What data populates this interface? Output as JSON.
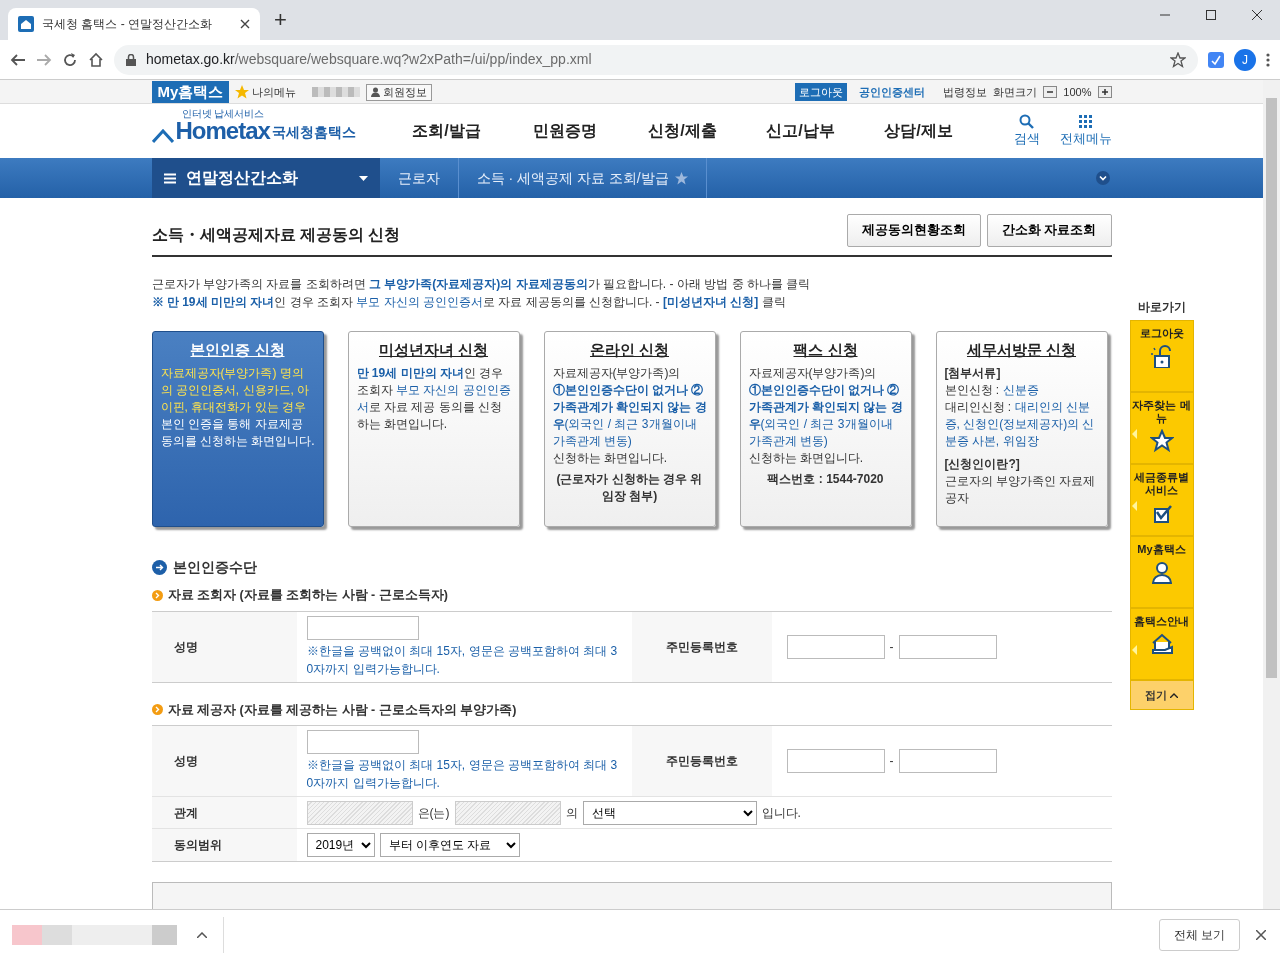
{
  "browser": {
    "tab_title": "국세청 홈택스 - 연말정산간소화",
    "new_tab": "+",
    "address_host": "hometax.go.kr",
    "address_path": "/websquare/websquare.wq?w2xPath=/ui/pp/index_pp.xml",
    "profile": "J"
  },
  "utility_bar": {
    "my_label": "My홈택스",
    "my_menu": "나의메뉴",
    "member_info": "회원정보",
    "logout": "로그아웃",
    "cert_center": "공인인증센터",
    "links": [
      "법령정보",
      "화면크기"
    ],
    "zoom": "100%"
  },
  "header": {
    "logo_tagline": "인터넷 납세서비스",
    "logo": "Hometax",
    "logo_suffix": "국세청홈택스",
    "menu": [
      "조회/발급",
      "민원증명",
      "신청/제출",
      "신고/납부",
      "상담/제보"
    ],
    "tools": [
      {
        "label": "검색",
        "kind": "search"
      },
      {
        "label": "전체메뉴",
        "kind": "grid"
      }
    ]
  },
  "breadcrumb": {
    "section": "연말정산간소화",
    "items": [
      "근로자",
      "소득 · 세액공제 자료 조회/발급"
    ]
  },
  "page": {
    "title": "소득・세액공제자료 제공동의 신청",
    "buttons": [
      "제공동의현황조회",
      "간소화 자료조회"
    ],
    "notice": [
      [
        {
          "text": "근로자가 부양가족의 자료를 조회하려면 ",
          "kind": "plain"
        },
        {
          "text": "그 부양가족(자료제공자)의 자료제공동의",
          "kind": "strong"
        },
        {
          "text": "가 필요합니다. - 아래 방법 중 하나를 클릭",
          "kind": "plain"
        }
      ],
      [
        {
          "text": "※ 만 19세 미만의 자녀",
          "kind": "strong"
        },
        {
          "text": "인 경우 조회자 ",
          "kind": "plain"
        },
        {
          "text": "부모 자신의 공인인증서",
          "kind": "link"
        },
        {
          "text": "로 자료 제공동의를 신청합니다. - ",
          "kind": "plain"
        },
        {
          "text": "[미성년자녀 신청]",
          "kind": "strong"
        },
        {
          "text": " 클릭",
          "kind": "plain"
        }
      ]
    ]
  },
  "cards": [
    {
      "title": "본인인증 신청",
      "selected": true,
      "paragraphs": [
        [
          {
            "text": "자료제공자(부양가족) 명의의 공인인증서, 신용카드, 아이핀,  휴대전화가 있는 경우",
            "kind": "highlight"
          },
          {
            "text": " 본인 인증을 통해 자료제공 동의를 신청하는 화면입니다.",
            "kind": "plain"
          }
        ]
      ]
    },
    {
      "title": "미성년자녀 신청",
      "selected": false,
      "paragraphs": [
        [
          {
            "text": "만 19세 미만의 자녀",
            "kind": "strong"
          },
          {
            "text": "인 경우 조회자 ",
            "kind": "plain"
          },
          {
            "text": "부모 자신의 공인인증서",
            "kind": "link"
          },
          {
            "text": "로 자료 제공 동의를 신청하는 화면입니다.",
            "kind": "plain"
          }
        ]
      ]
    },
    {
      "title": "온라인 신청",
      "selected": false,
      "paragraphs": [
        [
          {
            "text": "자료제공자(부양가족)의",
            "kind": "plain"
          }
        ],
        [
          {
            "text": "①본인인증수단이 없거나 ②가족관계가 확인되지 않는 경우",
            "kind": "strong"
          },
          {
            "text": "(외국인 / 최근 3개월이내 가족관계 변동)",
            "kind": "link"
          }
        ],
        [
          {
            "text": "신청하는 화면입니다.",
            "kind": "plain"
          }
        ],
        [
          {
            "text": "(근로자가 신청하는 경우 위임장 첨부)",
            "kind": "note"
          }
        ]
      ]
    },
    {
      "title": "팩스 신청",
      "selected": false,
      "paragraphs": [
        [
          {
            "text": "자료제공자(부양가족)의",
            "kind": "plain"
          }
        ],
        [
          {
            "text": "①본인인증수단이 없거나 ②가족관계가 확인되지 않는 경우",
            "kind": "strong"
          },
          {
            "text": "(외국인 / 최근 3개월이내 가족관계 변동)",
            "kind": "link"
          }
        ],
        [
          {
            "text": "신청하는 화면입니다.",
            "kind": "plain"
          }
        ],
        [
          {
            "text": "팩스번호 : 1544-7020",
            "kind": "note"
          }
        ]
      ]
    },
    {
      "title": "세무서방문 신청",
      "selected": false,
      "paragraphs": [
        [
          {
            "text": "[첨부서류]",
            "kind": "bold"
          }
        ],
        [
          {
            "text": "본인신청 : ",
            "kind": "plain"
          },
          {
            "text": "신분증",
            "kind": "link"
          }
        ],
        [
          {
            "text": "대리인신청 : ",
            "kind": "plain"
          },
          {
            "text": "대리인의 신분증, 신청인(정보제공자)의 신분증 사본, 위임장",
            "kind": "link"
          }
        ],
        [
          {
            "text": "[신청인이란?]",
            "kind": "bold"
          }
        ],
        [
          {
            "text": "근로자의 부양가족인 자료제공자",
            "kind": "plain"
          }
        ]
      ]
    }
  ],
  "form": {
    "heading": "본인인증수단",
    "sections": [
      {
        "title": "자료 조회자 (자료를 조회하는 사람 - 근로소득자)",
        "rows": [
          {
            "kind": "name-id",
            "label": "성명",
            "hint": "※한글을 공백없이 최대 15자, 영문은 공백포함하여 최대 30자까지 입력가능합니다.",
            "id_label": "주민등록번호",
            "separator": "-"
          }
        ]
      },
      {
        "title": "자료 제공자 (자료를 제공하는 사람 - 근로소득자의 부양가족)",
        "rows": [
          {
            "kind": "name-id",
            "label": "성명",
            "hint": "※한글을 공백없이 최대 15자, 영문은 공백포함하여 최대 30자까지 입력가능합니다.",
            "id_label": "주민등록번호",
            "separator": "-"
          },
          {
            "kind": "relation",
            "label": "관계",
            "between": "은(는)",
            "of": "의",
            "select": "선택",
            "suffix": "입니다."
          },
          {
            "kind": "range",
            "label": "동의범위",
            "year": "2019년",
            "scope": "부터 이후연도 자료"
          }
        ]
      }
    ]
  },
  "quick_links": {
    "title": "바로가기",
    "items": [
      {
        "label": "로그아웃",
        "kind": "lock",
        "submenu": false
      },
      {
        "label": "자주찾는 메뉴",
        "kind": "star",
        "submenu": true
      },
      {
        "label": "세금종류별 서비스",
        "kind": "check",
        "submenu": true
      },
      {
        "label": "My홈택스",
        "kind": "person",
        "submenu": false
      },
      {
        "label": "홈택스안내",
        "kind": "house",
        "submenu": true
      }
    ],
    "collapse": "접기"
  },
  "downloads": {
    "show_all": "전체 보기"
  }
}
